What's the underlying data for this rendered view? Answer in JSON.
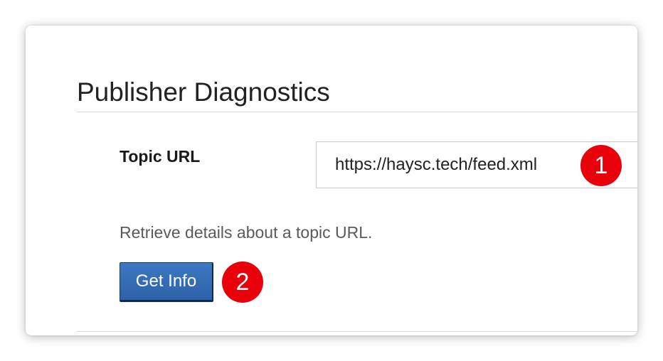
{
  "section": {
    "title": "Publisher Diagnostics"
  },
  "form": {
    "topic_url_label": "Topic URL",
    "topic_url_value": "https://haysc.tech/feed.xml",
    "help_text": "Retrieve details about a topic URL.",
    "get_info_label": "Get Info"
  },
  "annotations": {
    "step_1": "1",
    "step_2": "2"
  },
  "colors": {
    "button": "#2d62a7",
    "badge": "#e8000b",
    "rule": "#dadada"
  }
}
